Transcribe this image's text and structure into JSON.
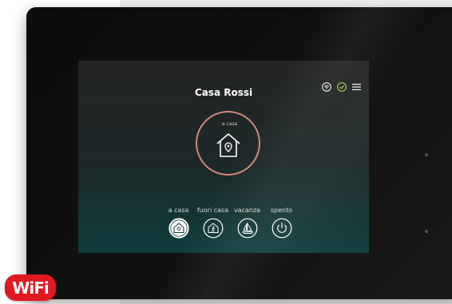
{
  "header": {
    "title": "Casa Rossi"
  },
  "status": {
    "ring_label": "a casa",
    "ring_color": "#d4867a",
    "accent": "#ffffff",
    "ok_color": "#b9e14a"
  },
  "top_icons": [
    "wifi-icon",
    "check-circle-icon",
    "menu-icon"
  ],
  "modes": [
    {
      "label": "a casa",
      "icon": "home-icon",
      "active": true
    },
    {
      "label": "fuori casa",
      "icon": "away-icon",
      "active": false
    },
    {
      "label": "vacanza",
      "icon": "vacation-icon",
      "active": false
    },
    {
      "label": "spento",
      "icon": "power-icon",
      "active": false
    }
  ],
  "logo": {
    "text": "WiFi",
    "color": "#e01822"
  }
}
